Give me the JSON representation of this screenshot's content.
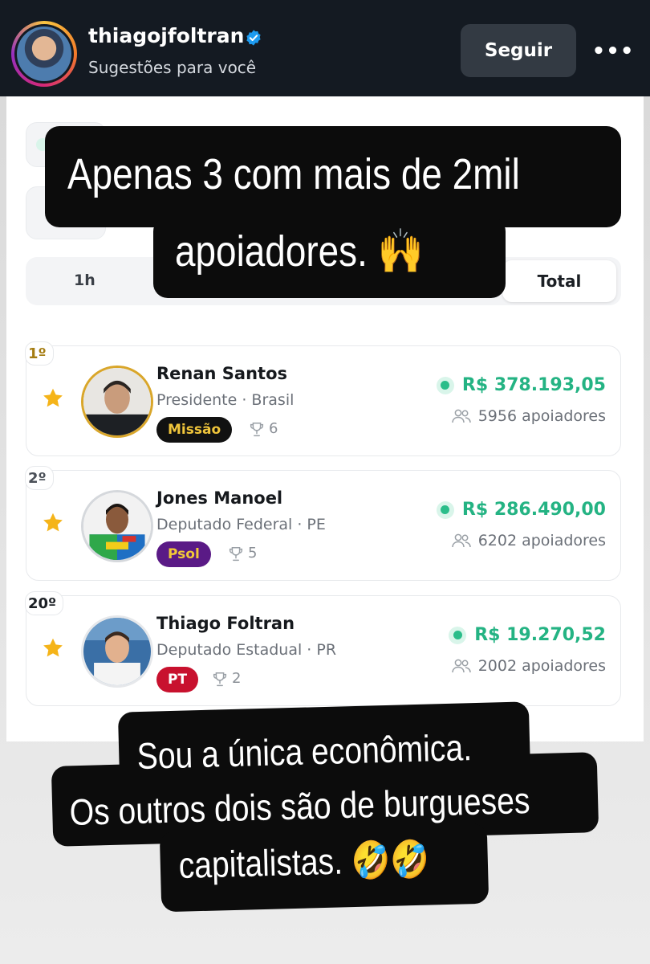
{
  "story": {
    "username": "thiagojfoltran",
    "subtitle": "Sugestões para você",
    "follow_label": "Seguir",
    "more_label": "•••",
    "avatar_icon": "profile-avatar",
    "verified_icon": "verified-badge-icon"
  },
  "ranking": {
    "tab_1h": "1h",
    "tab_total": "Total",
    "entries": [
      {
        "rank": "1º",
        "name": "Renan Santos",
        "role": "Presidente · Brasil",
        "party": "Missão",
        "party_bg": "#111111",
        "party_fg": "#f0c53b",
        "trophies": "6",
        "amount": "R$ 378.193,05",
        "supporters": "5956 apoiadores"
      },
      {
        "rank": "2º",
        "name": "Jones Manoel",
        "role": "Deputado Federal · PE",
        "party": "Psol",
        "party_bg": "#5a1a86",
        "party_fg": "#f2c937",
        "trophies": "5",
        "amount": "R$ 286.490,00",
        "supporters": "6202 apoiadores"
      },
      {
        "rank": "20º",
        "name": "Thiago Foltran",
        "role": "Deputado Estadual · PR",
        "party": "PT",
        "party_bg": "#c8112e",
        "party_fg": "#ffffff",
        "trophies": "2",
        "amount": "R$ 19.270,52",
        "supporters": "2002 apoiadores"
      }
    ]
  },
  "captions": {
    "top_line1": "Apenas 3 com mais de 2mil",
    "top_line2": "apoiadores. 🙌",
    "bottom_line1": "Sou a única econômica.",
    "bottom_line2": "Os outros dois são de burgueses",
    "bottom_line3": "capitalistas. 🤣🤣"
  },
  "colors": {
    "accent_green": "#24b383",
    "star_gold": "#f5b419",
    "header_bg": "#141a22"
  }
}
